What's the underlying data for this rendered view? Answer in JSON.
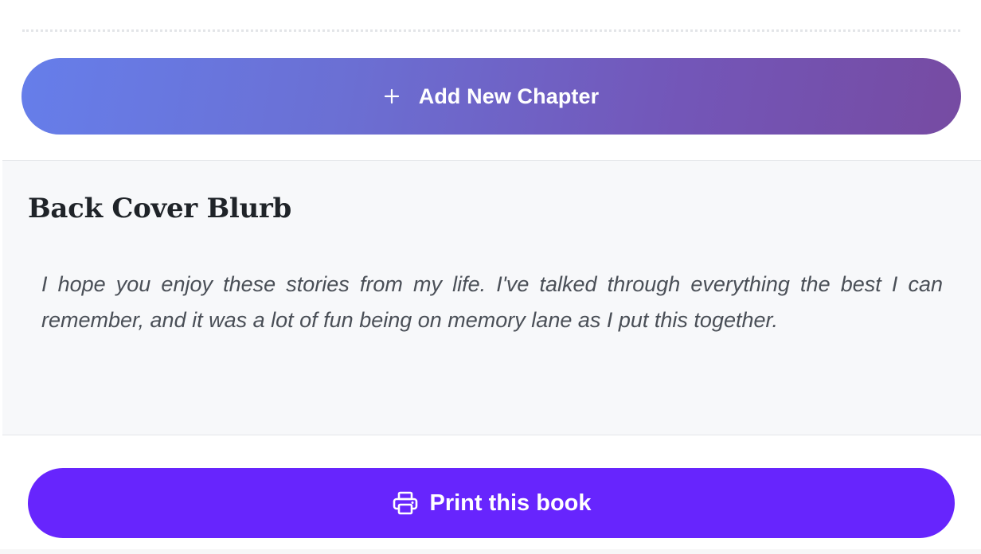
{
  "actions": {
    "add_chapter_label": "Add New Chapter",
    "add_chapter_icon": "plus-icon",
    "print_label": "Print this book",
    "print_icon": "printer-icon"
  },
  "blurb": {
    "title": "Back Cover Blurb",
    "text": "I hope you enjoy these stories from my life. I've talked through everything the best I can remember, and it was a lot of fun being on memory lane as I put this together."
  },
  "colors": {
    "add_chapter_gradient_start": "#667eea",
    "add_chapter_gradient_end": "#764ba2",
    "print_button": "#6725fd",
    "blurb_background": "#f7f8fa"
  }
}
